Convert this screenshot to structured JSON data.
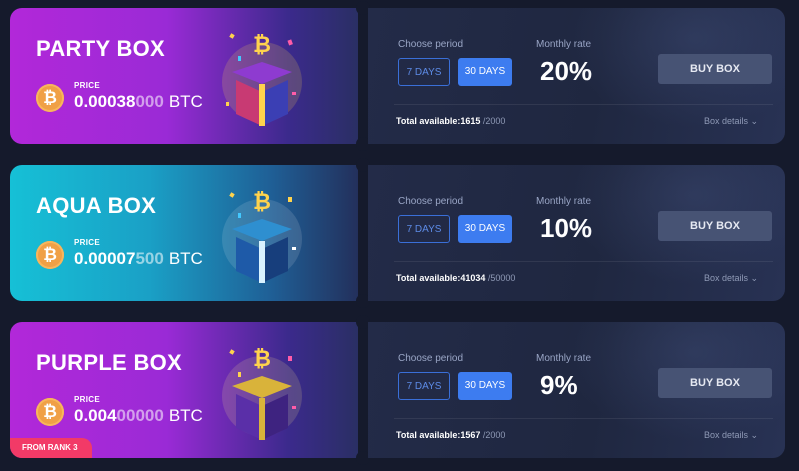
{
  "common": {
    "price_label": "PRICE",
    "choose_period_label": "Choose period",
    "monthly_rate_label": "Monthly rate",
    "period_7": "7 DAYS",
    "period_30": "30 DAYS",
    "buy_label": "BUY BOX",
    "total_label": "Total available:",
    "details_label": "Box details",
    "coin_symbol": "₿",
    "box_symbol": "₿",
    "chevron": "⌄"
  },
  "boxes": [
    {
      "name": "PARTY BOX",
      "price_main": "0.00038",
      "price_dim": "000",
      "currency": "BTC",
      "rate": "20%",
      "available": "1615",
      "total": "/2000",
      "selected_period": "30 DAYS",
      "colors": {
        "cube": "#c83a73",
        "lid": "#8e3bd0",
        "glow": "#ffd34d"
      }
    },
    {
      "name": "AQUA BOX",
      "price_main": "0.00007",
      "price_dim": "500",
      "currency": "BTC",
      "rate": "10%",
      "available": "41034",
      "total": "/50000",
      "selected_period": "30 DAYS",
      "colors": {
        "cube": "#1e5aa8",
        "lid": "#2e8fd0",
        "glow": "#ffffff"
      }
    },
    {
      "name": "PURPLE BOX",
      "price_main": "0.004",
      "price_dim": "00000",
      "currency": "BTC",
      "rate": "9%",
      "available": "1567",
      "total": "/2000",
      "selected_period": "30 DAYS",
      "badge": "FROM RANK 3",
      "colors": {
        "cube": "#5a2fa8",
        "lid": "#d9b33a",
        "glow": "#ffe98a"
      }
    }
  ]
}
